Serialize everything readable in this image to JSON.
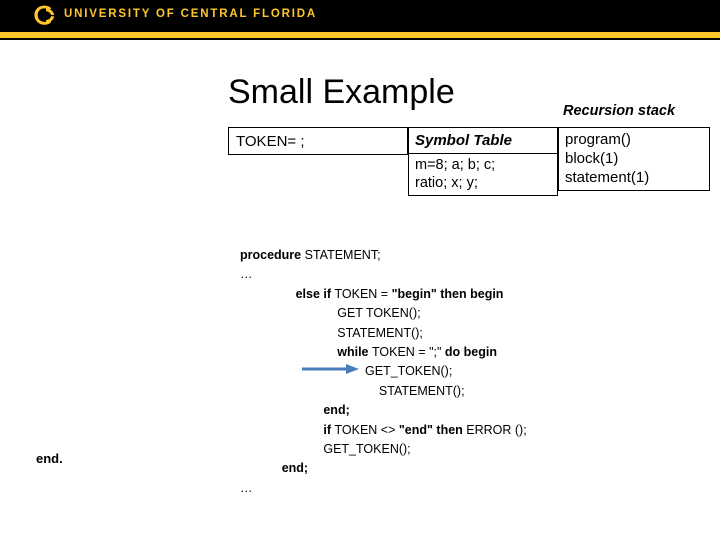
{
  "header": {
    "logo_icon": "ucf-pegasus-logo",
    "title": "UNIVERSITY OF CENTRAL FLORIDA",
    "bar_color": "#FFC72C",
    "band_color": "#000000"
  },
  "slide": {
    "title": "Small Example",
    "outer_end_label": "end."
  },
  "token_box": {
    "value": "TOKEN= ;"
  },
  "symbol_table": {
    "header": "Symbol Table",
    "rows": [
      "m=8; a; b; c;",
      "ratio; x; y;"
    ]
  },
  "recursion_stack": {
    "caption": "Recursion stack",
    "frames": [
      "program()",
      "block(1)",
      "statement(1)"
    ]
  },
  "code": {
    "lines": [
      {
        "indent": 0,
        "segments": [
          {
            "text": "procedure ",
            "bold": true
          },
          {
            "text": "STATEMENT;",
            "bold": false
          }
        ]
      },
      {
        "indent": 0,
        "segments": [
          {
            "text": "…",
            "bold": false
          }
        ]
      },
      {
        "indent": 4,
        "segments": [
          {
            "text": "else if ",
            "bold": true
          },
          {
            "text": "TOKEN = ",
            "bold": false
          },
          {
            "text": "\"begin\" then begin",
            "bold": true
          }
        ]
      },
      {
        "indent": 7,
        "segments": [
          {
            "text": "GET TOKEN();",
            "bold": false
          }
        ]
      },
      {
        "indent": 7,
        "segments": [
          {
            "text": "STATEMENT();",
            "bold": false
          }
        ]
      },
      {
        "indent": 7,
        "segments": [
          {
            "text": "while ",
            "bold": true
          },
          {
            "text": "TOKEN = \";\" ",
            "bold": false
          },
          {
            "text": "do begin",
            "bold": true
          }
        ]
      },
      {
        "indent": 9,
        "segments": [
          {
            "text": "GET_TOKEN();",
            "bold": false
          }
        ]
      },
      {
        "indent": 10,
        "segments": [
          {
            "text": "STATEMENT();",
            "bold": false
          }
        ]
      },
      {
        "indent": 6,
        "segments": [
          {
            "text": "end;",
            "bold": true
          }
        ]
      },
      {
        "indent": 6,
        "segments": [
          {
            "text": "if ",
            "bold": true
          },
          {
            "text": "TOKEN <> ",
            "bold": false
          },
          {
            "text": "\"end\" then ",
            "bold": true
          },
          {
            "text": "ERROR ();",
            "bold": false
          }
        ]
      },
      {
        "indent": 6,
        "segments": [
          {
            "text": "GET_TOKEN();",
            "bold": false
          }
        ]
      },
      {
        "indent": 3,
        "segments": [
          {
            "text": "end;",
            "bold": true
          }
        ]
      },
      {
        "indent": 0,
        "segments": [
          {
            "text": "…",
            "bold": false
          }
        ]
      }
    ]
  },
  "annotation": {
    "arrow_icon": "right-arrow-icon",
    "arrow_color": "#4A7EBB",
    "points_to": "GET_TOKEN();"
  }
}
